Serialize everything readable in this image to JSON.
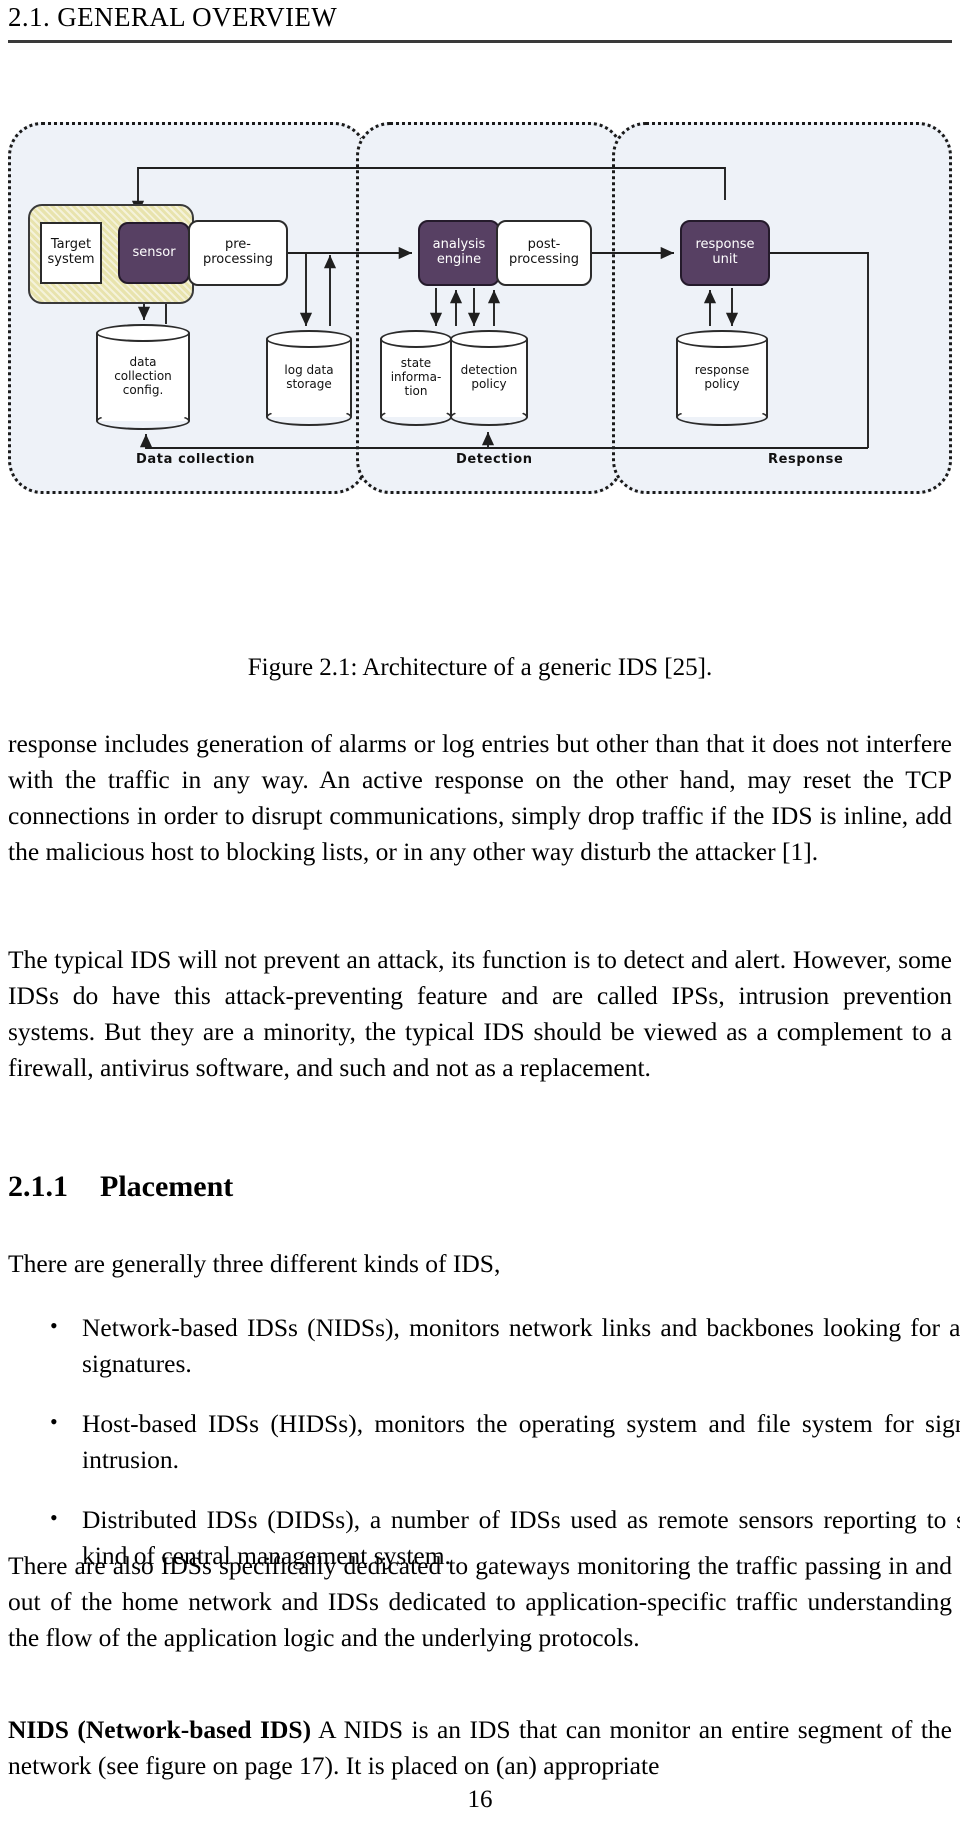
{
  "header": {
    "title": "2.1.  GENERAL OVERVIEW"
  },
  "figure": {
    "caption": "Figure 2.1: Architecture of a generic IDS [25].",
    "colors": {
      "region_fill": "#eef2f8",
      "region_border": "#1a1a1a",
      "accent_box": "#574063",
      "target_container": "#e8e3ad",
      "box_border": "#2b2b2b"
    },
    "regions": [
      {
        "key": "data-collection",
        "label": "Data collection"
      },
      {
        "key": "detection",
        "label": "Detection"
      },
      {
        "key": "response",
        "label": "Response"
      }
    ],
    "nodes": {
      "target_system": "Target\nsystem",
      "target_system_line1": "Target",
      "target_system_line2": "system",
      "sensor": "sensor",
      "preprocessing_line1": "pre-",
      "preprocessing_line2": "processing",
      "analysis_line1": "analysis",
      "analysis_line2": "engine",
      "postprocessing_line1": "post-",
      "postprocessing_line2": "processing",
      "response_unit_line1": "response",
      "response_unit_line2": "unit"
    },
    "stores": {
      "data_collection_config_l1": "data",
      "data_collection_config_l2": "collection",
      "data_collection_config_l3": "config.",
      "log_data_storage_l1": "log data",
      "log_data_storage_l2": "storage",
      "state_information_l1": "state",
      "state_information_l2": "informa-",
      "state_information_l3": "tion",
      "detection_policy_l1": "detection",
      "detection_policy_l2": "policy",
      "response_policy_l1": "response",
      "response_policy_l2": "policy"
    }
  },
  "body": {
    "paragraph_1": "response includes generation of alarms or log entries but other than that it does not interfere with the traffic in any way. An active response on the other hand, may reset the TCP connections in order to disrupt communications, simply drop traffic if the IDS is inline, add the malicious host to blocking lists, or in any other way disturb the attacker [1].",
    "paragraph_2": "The typical IDS will not prevent an attack, its function is to detect and alert. However, some IDSs do have this attack-preventing feature and are called IPSs, intrusion prevention systems. But they are a minority, the typical IDS should be viewed as a complement to a firewall, antivirus software, and such and not as a replacement.",
    "subsection": {
      "number": "2.1.1",
      "title": "Placement"
    },
    "intro": "There are generally three different kinds of IDS,",
    "bullets": [
      "Network-based IDSs (NIDSs), monitors network links and backbones looking for attack signatures.",
      "Host-based IDSs (HIDSs), monitors the operating system and file system for signs of intrusion.",
      "Distributed IDSs (DIDSs), a number of IDSs used as remote sensors reporting to some kind of central management system."
    ],
    "paragraph_also": "There are also IDSs specifically dedicated to gateways monitoring the traffic passing in and out of the home network and IDSs dedicated to application-specific traffic understanding the flow of the application logic and the underlying protocols.",
    "nids_term": "NIDS (Network-based IDS)",
    "nids_text": " A NIDS is an IDS that can monitor an entire segment of the network (see figure on page 17). It is placed on (an) appropriate"
  },
  "footer": {
    "page_number": "16"
  }
}
